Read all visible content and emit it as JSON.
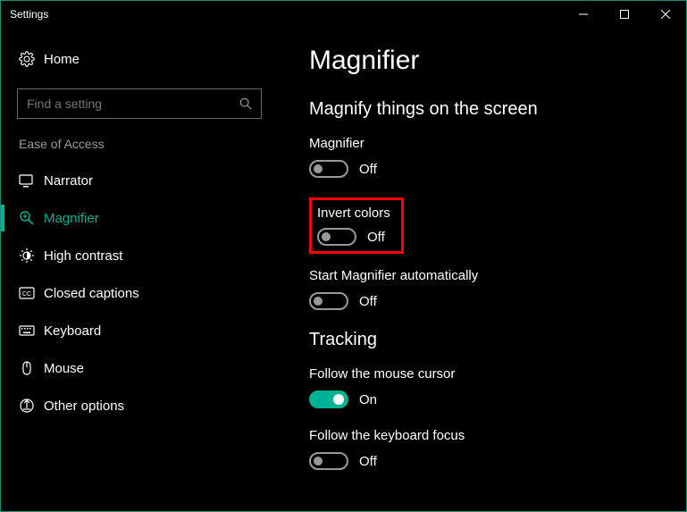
{
  "window": {
    "title": "Settings"
  },
  "sidebar": {
    "home_label": "Home",
    "search_placeholder": "Find a setting",
    "category_label": "Ease of Access",
    "items": [
      {
        "label": "Narrator",
        "icon": "narrator-icon",
        "active": false
      },
      {
        "label": "Magnifier",
        "icon": "magnifier-icon",
        "active": true
      },
      {
        "label": "High contrast",
        "icon": "high-contrast-icon",
        "active": false
      },
      {
        "label": "Closed captions",
        "icon": "closed-captions-icon",
        "active": false
      },
      {
        "label": "Keyboard",
        "icon": "keyboard-icon",
        "active": false
      },
      {
        "label": "Mouse",
        "icon": "mouse-icon",
        "active": false
      },
      {
        "label": "Other options",
        "icon": "other-options-icon",
        "active": false
      }
    ]
  },
  "main": {
    "title": "Magnifier",
    "section1_title": "Magnify things on the screen",
    "settings": {
      "magnifier": {
        "label": "Magnifier",
        "status": "Off",
        "on": false
      },
      "invert_colors": {
        "label": "Invert colors",
        "status": "Off",
        "on": false,
        "highlighted": true
      },
      "start_auto": {
        "label": "Start Magnifier automatically",
        "status": "Off",
        "on": false
      }
    },
    "section2_title": "Tracking",
    "tracking": {
      "follow_mouse": {
        "label": "Follow the mouse cursor",
        "status": "On",
        "on": true
      },
      "follow_keyboard": {
        "label": "Follow the keyboard focus",
        "status": "Off",
        "on": false
      }
    }
  },
  "colors": {
    "accent": "#00b294",
    "highlight": "#ff0000"
  }
}
